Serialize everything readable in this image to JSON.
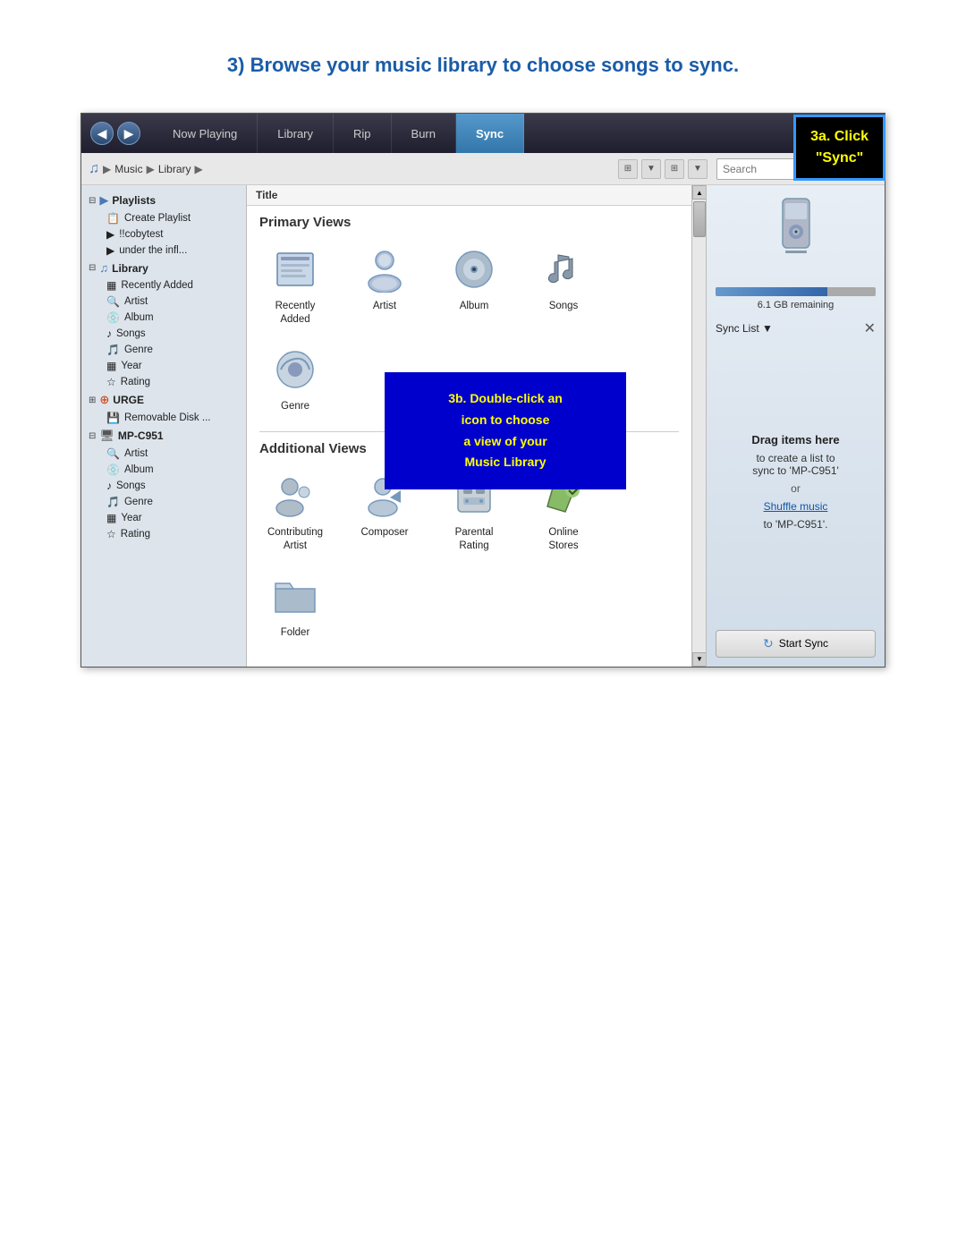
{
  "page": {
    "title": "3) Browse your music library to choose songs to sync."
  },
  "navbar": {
    "back_label": "◀",
    "fwd_label": "▶",
    "tabs": [
      {
        "label": "Now Playing",
        "active": false
      },
      {
        "label": "Library",
        "active": false
      },
      {
        "label": "Rip",
        "active": false
      },
      {
        "label": "Burn",
        "active": false
      },
      {
        "label": "Sync",
        "active": true
      }
    ],
    "chevron": "»"
  },
  "breadcrumb": {
    "icon": "♫",
    "parts": [
      "Music",
      "Library"
    ],
    "search_placeholder": "Search"
  },
  "column_header": {
    "title": "Title"
  },
  "sidebar": {
    "playlists": {
      "label": "Playlists",
      "items": [
        {
          "icon": "📋",
          "label": "Create Playlist"
        },
        {
          "icon": "▶",
          "label": "!!cobytest"
        },
        {
          "icon": "▶",
          "label": "under the infl..."
        }
      ]
    },
    "library": {
      "label": "Library",
      "items": [
        {
          "icon": "▦",
          "label": "Recently Added"
        },
        {
          "icon": "🔍",
          "label": "Artist"
        },
        {
          "icon": "💿",
          "label": "Album"
        },
        {
          "icon": "♪",
          "label": "Songs"
        },
        {
          "icon": "🎵",
          "label": "Genre"
        },
        {
          "icon": "▦",
          "label": "Year"
        },
        {
          "icon": "☆",
          "label": "Rating"
        }
      ]
    },
    "urge": {
      "label": "URGE",
      "icon": "⊕"
    },
    "removable": {
      "label": "Removable Disk ..."
    },
    "mp": {
      "label": "MP-C951",
      "items": [
        {
          "icon": "🔍",
          "label": "Artist"
        },
        {
          "icon": "💿",
          "label": "Album"
        },
        {
          "icon": "♪",
          "label": "Songs"
        },
        {
          "icon": "🎵",
          "label": "Genre"
        },
        {
          "icon": "▦",
          "label": "Year"
        },
        {
          "icon": "☆",
          "label": "Rating"
        }
      ]
    }
  },
  "primary_views": {
    "heading": "Primary Views",
    "items": [
      {
        "label": "Recently\nAdded"
      },
      {
        "label": "Artist"
      },
      {
        "label": "Album"
      },
      {
        "label": "Songs"
      }
    ]
  },
  "additional_views": {
    "heading": "Additional Views",
    "items": [
      {
        "label": "Contributing\nArtist"
      },
      {
        "label": "Composer"
      },
      {
        "label": "Parental\nRating"
      },
      {
        "label": "Online\nStores"
      }
    ],
    "items2": [
      {
        "label": "Folder"
      }
    ]
  },
  "genre_label": "Genre",
  "sync_panel": {
    "storage_text": "6.1 GB remaining",
    "sync_list_label": "Sync List ▼",
    "drop_bold": "Drag items here",
    "drop_sub": "to create a list to\nsync to 'MP-C951'",
    "or_text": "or",
    "shuffle_link": "Shuffle music",
    "shuffle_sub": "to 'MP-C951'.",
    "start_sync": "Start Sync",
    "close": "✕"
  },
  "callout_3a": {
    "text": "3a. Click\n\"Sync\""
  },
  "callout_3b": {
    "text": "3b.  Double-click an\nicon  to  choose\na view of your\nMusic   Library"
  }
}
